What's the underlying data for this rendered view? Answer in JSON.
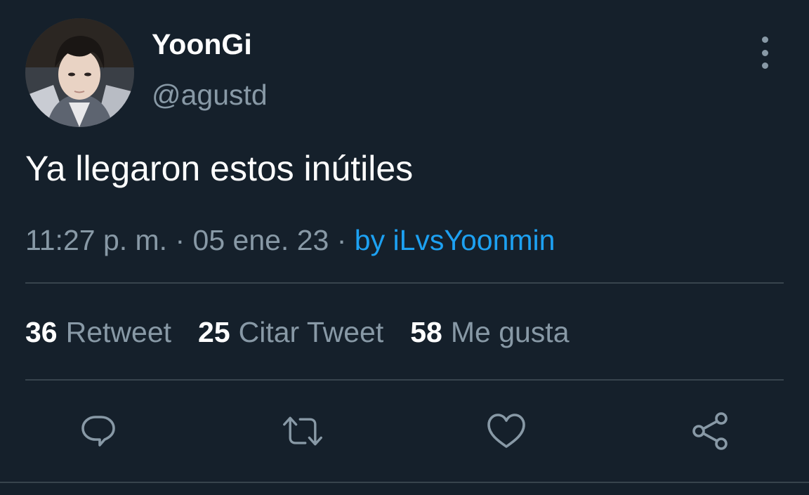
{
  "user": {
    "display_name": "YoonGi",
    "handle": "@agustd"
  },
  "tweet": {
    "text": "Ya llegaron estos inútiles",
    "time": "11:27 p. m.",
    "date": "05 ene. 23",
    "separator": "·",
    "source": "by iLvsYoonmin"
  },
  "stats": {
    "retweets": {
      "count": "36",
      "label": "Retweet"
    },
    "quotes": {
      "count": "25",
      "label": "Citar Tweet"
    },
    "likes": {
      "count": "58",
      "label": "Me gusta"
    }
  },
  "icons": {
    "more": "more-vertical-icon",
    "reply": "reply-icon",
    "retweet": "retweet-icon",
    "like": "heart-icon",
    "share": "share-icon"
  },
  "colors": {
    "background": "#15202b",
    "secondary_text": "#8899a6",
    "link": "#1da1f2",
    "divider": "#38444d"
  }
}
